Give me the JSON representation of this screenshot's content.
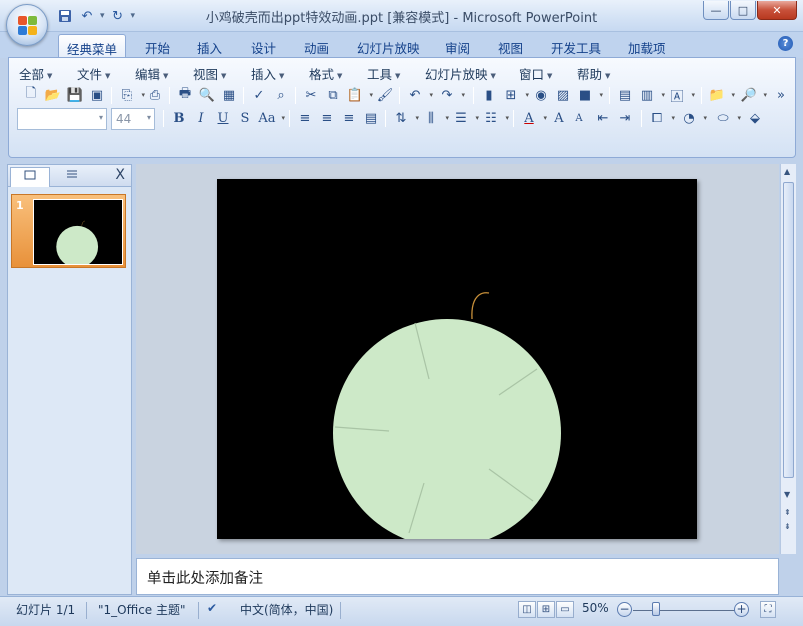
{
  "window": {
    "title": "小鸡破壳而出ppt特效动画.ppt [兼容模式] - Microsoft PowerPoint",
    "minimize": "—",
    "maximize": "□",
    "close": "✕"
  },
  "quick_access": {
    "save_icon": "save-icon",
    "undo_icon": "undo-icon",
    "redo_icon": "redo-icon",
    "customize_icon": "customize-icon"
  },
  "ribbon_tabs": [
    "经典菜单",
    "开始",
    "插入",
    "设计",
    "动画",
    "幻灯片放映",
    "审阅",
    "视图",
    "开发工具",
    "加载项"
  ],
  "menus": [
    "全部",
    "文件",
    "编辑",
    "视图",
    "插入",
    "格式",
    "工具",
    "幻灯片放映",
    "窗口",
    "帮助"
  ],
  "font": {
    "name_value": "",
    "size_value": "44"
  },
  "format_buttons": {
    "bold": "B",
    "italic": "I",
    "underline": "U",
    "shadow": "S",
    "case": "Aa",
    "font_color": "A",
    "grow": "A",
    "shrink": "A"
  },
  "thumbnail_pane": {
    "slide_number": "1",
    "close": "X"
  },
  "notes": {
    "placeholder": "单击此处添加备注"
  },
  "status": {
    "slide_info": "幻灯片 1/1",
    "theme": "\"1_Office 主题\"",
    "language": "中文(简体，中国)",
    "zoom": "50%",
    "zoom_fraction": 0.5
  },
  "colors": {
    "slide_bg": "#000000",
    "circle": "#cde9c8",
    "stem": "#c8903a",
    "thumb_selected": "#e8913a"
  }
}
